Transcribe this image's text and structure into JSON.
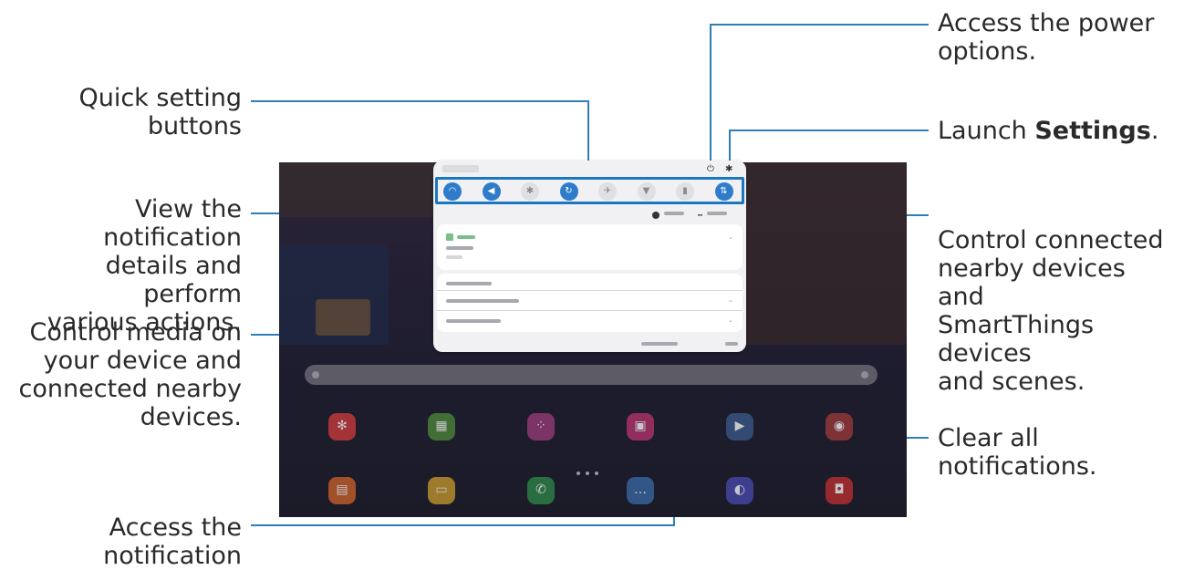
{
  "callouts": {
    "quick_setting_line1": "Quick setting",
    "quick_setting_line2": "buttons",
    "view_details_line1": "View the notification",
    "view_details_line2": "details and perform",
    "view_details_line3": "various actions.",
    "control_media_line1": "Control media on",
    "control_media_line2": "your device and",
    "control_media_line3": "connected nearby",
    "control_media_line4": "devices.",
    "notif_settings_line1": "Access the",
    "notif_settings_line2": "notification settings.",
    "power_line1": "Access the power",
    "power_line2": "options.",
    "launch_prefix": "Launch ",
    "launch_bold": "Settings",
    "launch_suffix": ".",
    "control_devices_line1": "Control connected",
    "control_devices_line2": "nearby devices and",
    "control_devices_line3": "SmartThings devices",
    "control_devices_line4": "and scenes.",
    "clear_line1": "Clear all",
    "clear_line2": "notifications."
  },
  "panel": {
    "power_icon": "power-icon",
    "settings_icon": "gear-icon",
    "quick_settings": [
      {
        "icon": "wifi-icon",
        "glyph": "◠",
        "state": "on"
      },
      {
        "icon": "sound-icon",
        "glyph": "◀",
        "state": "on"
      },
      {
        "icon": "bluetooth-icon",
        "glyph": "✱",
        "state": "off"
      },
      {
        "icon": "auto-rotate-icon",
        "glyph": "↻",
        "state": "on"
      },
      {
        "icon": "airplane-icon",
        "glyph": "✈",
        "state": "off"
      },
      {
        "icon": "flashlight-icon",
        "glyph": "▼",
        "state": "off"
      },
      {
        "icon": "battery-saver-icon",
        "glyph": "▮",
        "state": "off"
      },
      {
        "icon": "data-icon",
        "glyph": "⇅",
        "state": "on"
      }
    ]
  },
  "colors": {
    "callout_line": "#2f7fb6",
    "qs_highlight": "#1b78c0",
    "qs_on": "#2f7ccb"
  }
}
